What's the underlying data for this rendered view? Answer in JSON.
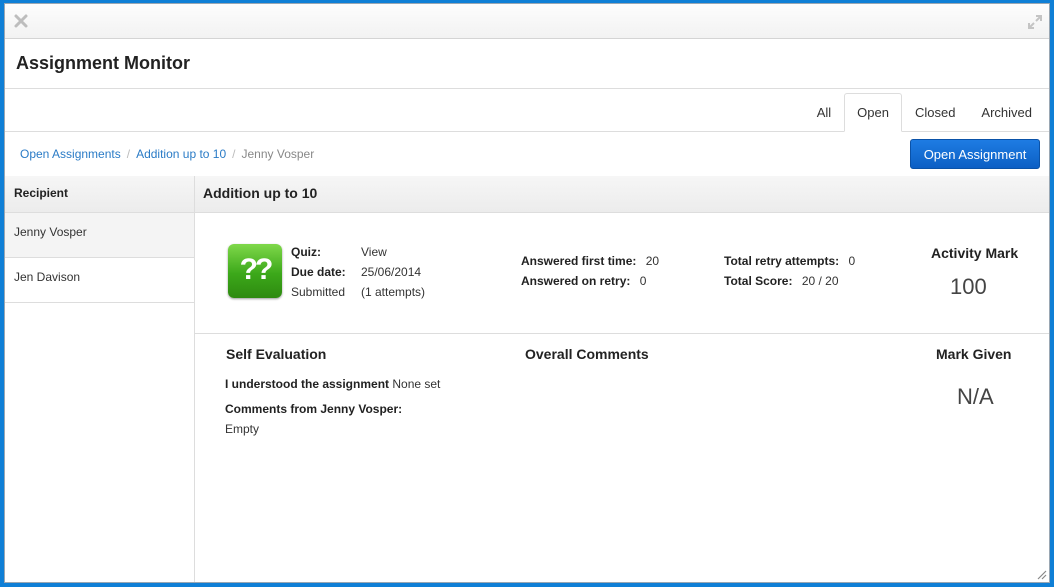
{
  "window": {
    "close_icon": "close-icon",
    "expand_icon": "expand-icon"
  },
  "header": {
    "title": "Assignment Monitor"
  },
  "tabs": [
    {
      "label": "All",
      "active": false
    },
    {
      "label": "Open",
      "active": true
    },
    {
      "label": "Closed",
      "active": false
    },
    {
      "label": "Archived",
      "active": false
    }
  ],
  "breadcrumb": {
    "items": [
      "Open Assignments",
      "Addition up to 10"
    ],
    "current": "Jenny Vosper",
    "separator": "/"
  },
  "open_button": {
    "label": "Open Assignment"
  },
  "recipients": {
    "header": "Recipient",
    "items": [
      "Jenny Vosper",
      "Jen Davison"
    ]
  },
  "assignment": {
    "title": "Addition up to 10",
    "icon_text": "??",
    "quiz_label": "Quiz:",
    "quiz_value": "View",
    "due_label": "Due date:",
    "due_value": "25/06/2014",
    "submitted_label": "Submitted",
    "submitted_value": "(1 attempts)",
    "first_time_label": "Answered first time:",
    "first_time_value": "20",
    "retry_label": "Answered on retry:",
    "retry_value": "0",
    "total_retry_label": "Total retry attempts:",
    "total_retry_value": "0",
    "total_score_label": "Total Score:",
    "total_score_value": "20 / 20",
    "activity_mark_label": "Activity Mark",
    "activity_mark_value": "100"
  },
  "evaluation": {
    "self_title": "Self Evaluation",
    "understood_label": "I understood the assignment",
    "understood_value": "None set",
    "comments_label": "Comments from Jenny Vosper:",
    "comments_value": "Empty",
    "overall_title": "Overall Comments",
    "mark_given_title": "Mark Given",
    "mark_given_value": "N/A"
  },
  "colors": {
    "accent": "#0f7fd6",
    "button": "#0c5fc4",
    "link": "#2a7bc6",
    "quiz_icon": "#3ca81a"
  }
}
